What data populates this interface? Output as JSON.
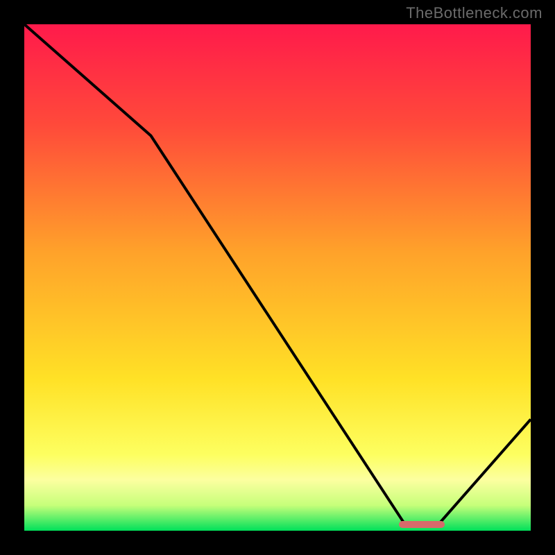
{
  "watermark": "TheBottleneck.com",
  "chart_data": {
    "type": "line",
    "title": "",
    "xlabel": "",
    "ylabel": "",
    "xlim": [
      0,
      100
    ],
    "ylim": [
      0,
      100
    ],
    "x": [
      0,
      25,
      75,
      82,
      100
    ],
    "values": [
      100,
      78,
      1.5,
      1.5,
      22
    ],
    "marker": {
      "x_start": 74,
      "x_end": 83,
      "y": 1.3
    },
    "gradient_stops": [
      {
        "pos": 0,
        "color": "#ff1a4b"
      },
      {
        "pos": 20,
        "color": "#ff4a3a"
      },
      {
        "pos": 45,
        "color": "#ffa22a"
      },
      {
        "pos": 70,
        "color": "#ffe126"
      },
      {
        "pos": 85,
        "color": "#fdff60"
      },
      {
        "pos": 90,
        "color": "#fcffa0"
      },
      {
        "pos": 95,
        "color": "#c6ff7a"
      },
      {
        "pos": 100,
        "color": "#00e05a"
      }
    ],
    "curve_color": "#000000",
    "plot_background_frame": "#000000"
  }
}
